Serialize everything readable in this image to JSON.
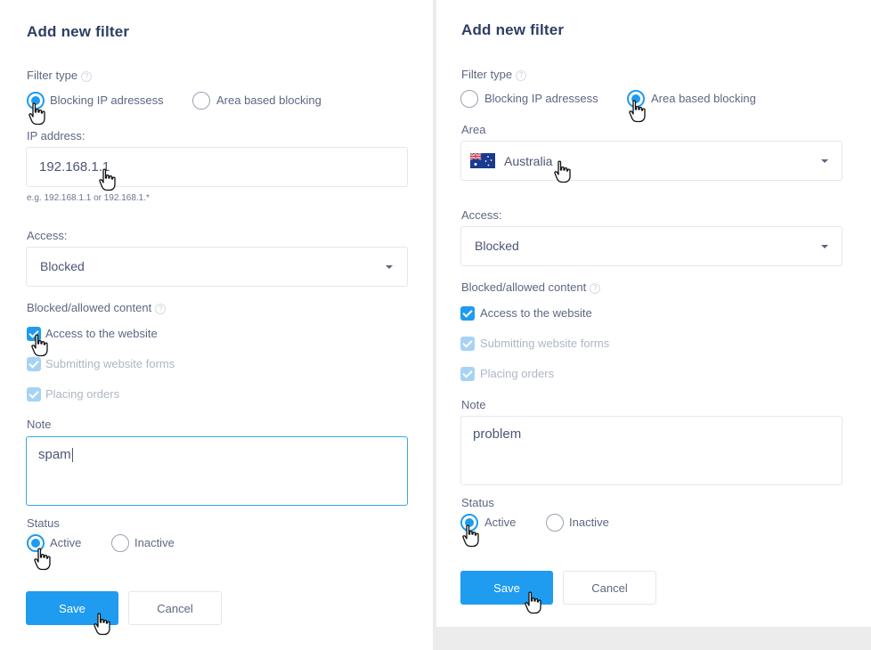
{
  "left": {
    "title": "Add new filter",
    "filter_type_label": "Filter type",
    "filter_options": [
      "Blocking IP adressess",
      "Area based blocking"
    ],
    "ip_label": "IP address:",
    "ip_value": "192.168.1.1",
    "ip_hint": "e.g. 192.168.1.1 or 192.168.1.*",
    "access_label": "Access:",
    "access_value": "Blocked",
    "content_label": "Blocked/allowed content",
    "content_options": [
      "Access to the website",
      "Submitting website forms",
      "Placing orders"
    ],
    "note_label": "Note",
    "note_value": "spam",
    "status_label": "Status",
    "status_options": [
      "Active",
      "Inactive"
    ],
    "save_label": "Save",
    "cancel_label": "Cancel"
  },
  "right": {
    "title": "Add new filter",
    "filter_type_label": "Filter type",
    "filter_options": [
      "Blocking IP adressess",
      "Area based blocking"
    ],
    "area_label": "Area",
    "area_value": "Australia",
    "access_label": "Access:",
    "access_value": "Blocked",
    "content_label": "Blocked/allowed content",
    "content_options": [
      "Access to the website",
      "Submitting website forms",
      "Placing orders"
    ],
    "note_label": "Note",
    "note_value": "problem",
    "status_label": "Status",
    "status_options": [
      "Active",
      "Inactive"
    ],
    "save_label": "Save",
    "cancel_label": "Cancel"
  },
  "colors": {
    "accent": "#1f9bf0",
    "title": "#2d3e63",
    "text": "#5d6782",
    "border": "#e3e7ee"
  },
  "icons": {
    "help": "question-circle-icon",
    "caret": "caret-down-icon",
    "pointer": "hand-pointer-icon",
    "flag": "australia-flag-icon"
  }
}
